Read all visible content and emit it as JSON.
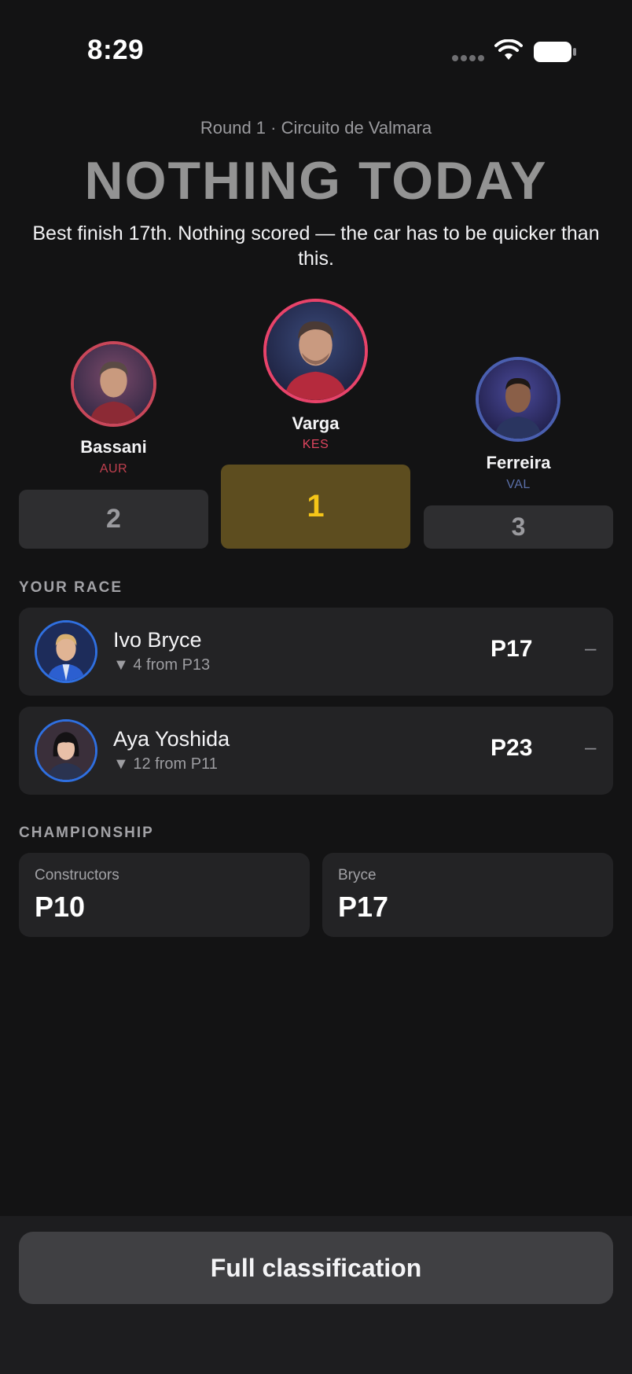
{
  "status_bar": {
    "time": "8:29"
  },
  "header": {
    "round": "Round 1 · Circuito de Valmara",
    "headline": "NOTHING TODAY",
    "summary": "Best finish 17th. Nothing scored — the car has to be quicker than this."
  },
  "podium": [
    {
      "position": "2",
      "name": "Bassani",
      "team": "AUR",
      "team_color": "#c0404f",
      "ring_color": "#c9475a"
    },
    {
      "position": "1",
      "name": "Varga",
      "team": "KES",
      "team_color": "#e0455f",
      "ring_color": "#e8436a"
    },
    {
      "position": "3",
      "name": "Ferreira",
      "team": "VAL",
      "team_color": "#5a6fa8",
      "ring_color": "#4a5fb0"
    }
  ],
  "your_race": {
    "label": "YOUR RACE",
    "drivers": [
      {
        "name": "Ivo Bryce",
        "delta": "▼ 4 from P13",
        "position": "P17",
        "points": "–"
      },
      {
        "name": "Aya Yoshida",
        "delta": "▼ 12 from P11",
        "position": "P23",
        "points": "–"
      }
    ]
  },
  "championship": {
    "label": "CHAMPIONSHIP",
    "cards": [
      {
        "label": "Constructors",
        "value": "P10"
      },
      {
        "label": "Bryce",
        "value": "P17"
      }
    ]
  },
  "footer": {
    "button_label": "Full classification"
  },
  "colors": {
    "background": "#131314",
    "card": "#232325",
    "gold_block": "#5d4d1f",
    "gold_text": "#f5c518",
    "block_gray": "#2e2e30",
    "driver_ring": "#2f6fe0"
  },
  "icons": {
    "signal": "cellular-signal-icon",
    "wifi": "wifi-icon",
    "battery": "battery-icon"
  }
}
